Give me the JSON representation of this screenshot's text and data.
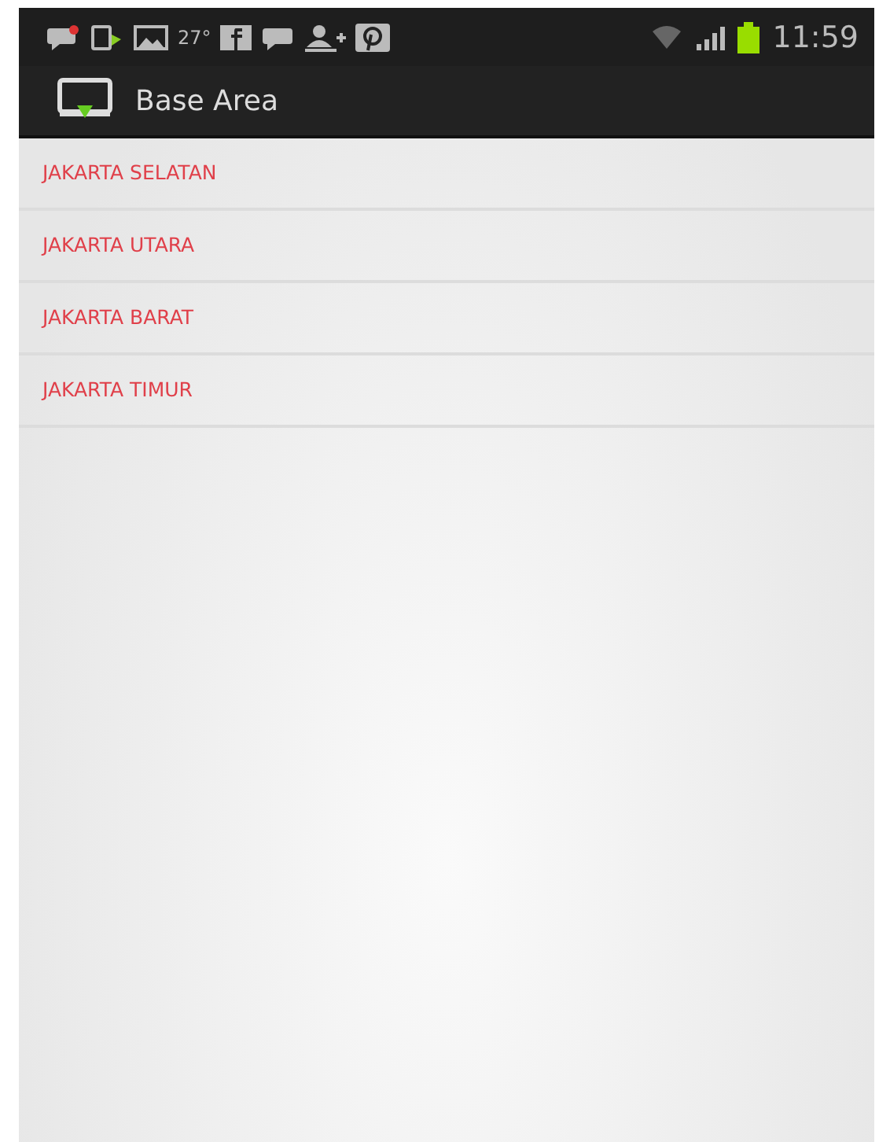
{
  "status_bar": {
    "temperature": "27°",
    "time": "11:59"
  },
  "action_bar": {
    "title": "Base Area"
  },
  "list": [
    {
      "label": "JAKARTA SELATAN"
    },
    {
      "label": "JAKARTA UTARA"
    },
    {
      "label": "JAKARTA BARAT"
    },
    {
      "label": "JAKARTA TIMUR"
    }
  ]
}
